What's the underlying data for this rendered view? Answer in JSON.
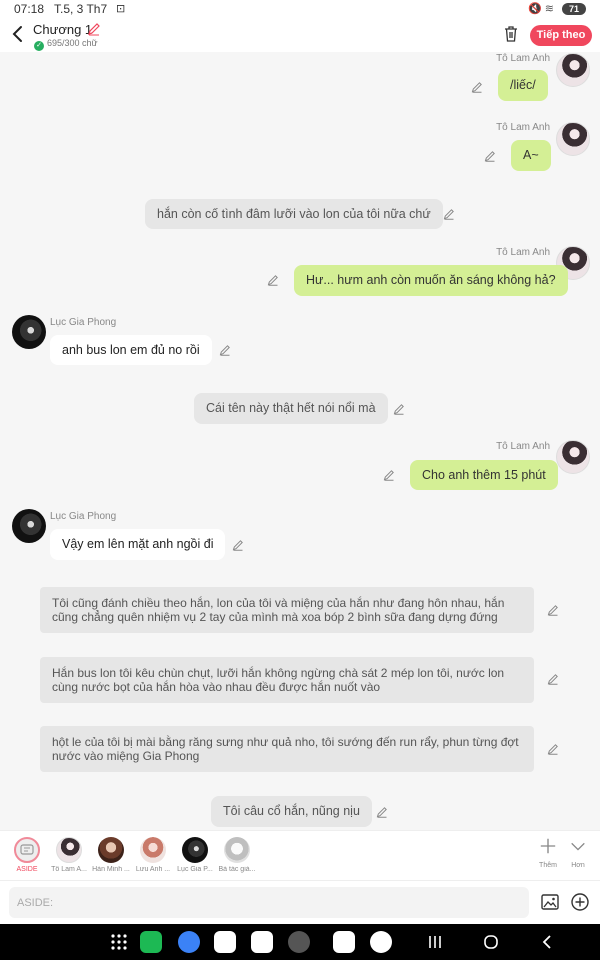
{
  "status": {
    "time": "07:18",
    "date": "T.5, 3 Th7",
    "battery": "71"
  },
  "header": {
    "title": "Chương 1",
    "word_count": "695/300 chữ",
    "next_label": "Tiếp theo"
  },
  "messages": [
    {
      "name": "Tô Lam Anh",
      "text": "/liếc/"
    },
    {
      "name": "Tô Lam Anh",
      "text": "A~"
    },
    {
      "text": "hắn còn cố tình đâm lưỡi vào lon của tôi nữa chứ"
    },
    {
      "name": "Tô Lam Anh",
      "text": "Hư... hưm anh còn muốn ăn sáng không hả?"
    },
    {
      "name": "Lục Gia Phong",
      "text": "anh bus lon em đủ no rồi"
    },
    {
      "text": "Cái tên này thật hết nói nổi mà"
    },
    {
      "name": "Tô Lam Anh",
      "text": "Cho anh thêm 15 phút"
    },
    {
      "name": "Lục Gia Phong",
      "text": "Vậy em lên mặt anh ngồi đi"
    },
    {
      "text": "Tôi cũng đánh chiều theo hắn, lon của tôi và miệng của hắn như đang hôn nhau, hắn cũng chẳng quên nhiệm vụ 2 tay của mình mà xoa bóp 2 bình sữa đang dựng đứng"
    },
    {
      "text": "Hắn bus lon tôi kêu chùn chụt, lưỡi hắn không ngừng chà sát 2 mép lon tôi, nước lon cùng nước bọt của hắn hòa vào nhau đều được hắn nuốt vào"
    },
    {
      "text": "hột le của tôi bị mài bằng răng sưng như quả nho, tôi sướng đến run rẩy, phun từng đợt nước vào miệng Gia Phong"
    },
    {
      "text": "Tôi câu cổ hắn, nũng nịu"
    }
  ],
  "characters": [
    {
      "label": "ASIDE"
    },
    {
      "label": "Tô Lam A..."
    },
    {
      "label": "Hàn Minh ..."
    },
    {
      "label": "Lưu Anh ..."
    },
    {
      "label": "Lục Gia P..."
    },
    {
      "label": "Bà tác giả..."
    }
  ],
  "controls": {
    "add_label": "Thêm",
    "more_label": "Hơn"
  },
  "input": {
    "placeholder": "ASIDE:"
  },
  "colors": {
    "accent": "#f0475d",
    "right_bubble": "#d4ef95",
    "aside_bubble": "#e6e6e6"
  },
  "icons": {
    "back": "chevron-left-icon",
    "edit": "pencil-icon",
    "trash": "trash-icon",
    "image": "image-icon",
    "plus": "plus-circle-icon"
  }
}
